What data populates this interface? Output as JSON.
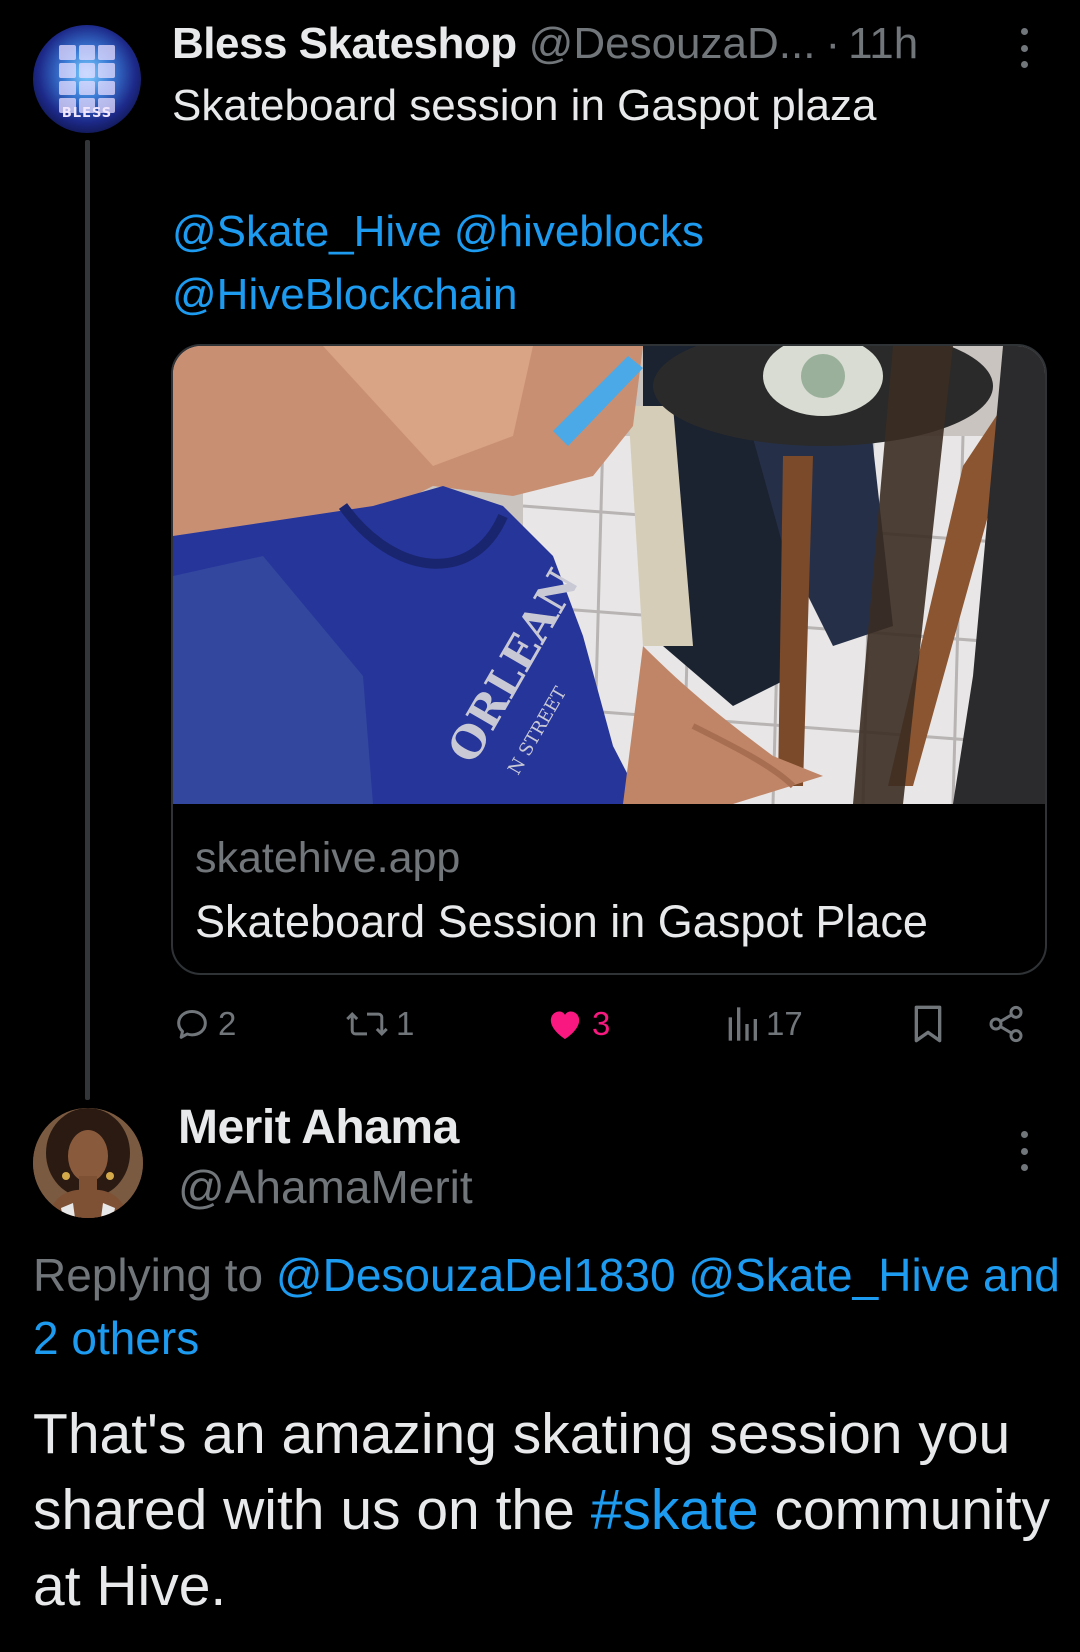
{
  "tweet": {
    "author_name": "Bless Skateshop",
    "author_handle": "@DesouzaD...",
    "separator": "·",
    "time": "11h",
    "avatar_text": "BLESS",
    "text_line1": "Skateboard session in Gaspot plaza",
    "mentions": [
      "@Skate_Hive",
      "@hiveblocks",
      "@HiveBlockchain"
    ],
    "card": {
      "domain": "skatehive.app",
      "title": "Skateboard Session in Gaspot Place",
      "image_shirt_text": "ORLEAN",
      "image_shirt_subtext": "N STREET"
    },
    "actions": {
      "replies": "2",
      "reposts": "1",
      "likes": "3",
      "views": "17"
    }
  },
  "reply": {
    "author_name": "Merit Ahama",
    "author_handle": "@AhamaMerit",
    "replying_prefix": "Replying to",
    "replying_to_1": "@DesouzaDel1830",
    "replying_to_2": "@Skate_Hive",
    "replying_and": "and",
    "replying_others": "2 others",
    "body_part1": "That's an amazing skating session you shared with us on the",
    "hashtag": "#skate",
    "body_part2": "community at Hive."
  },
  "colors": {
    "background": "#000000",
    "text": "#e7e9ea",
    "muted": "#71767b",
    "link": "#1d9bf0",
    "like": "#f91880"
  }
}
